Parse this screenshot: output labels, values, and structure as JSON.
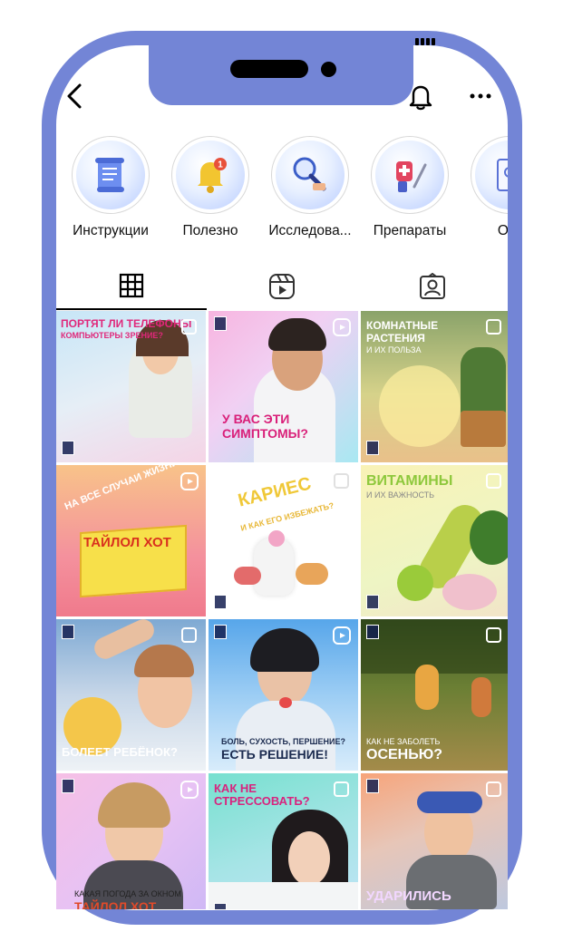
{
  "status_bar": {
    "time": ""
  },
  "highlights": [
    {
      "label": "Инструкции",
      "icon": "scroll-icon"
    },
    {
      "label": "Полезно",
      "icon": "bell-notification-icon",
      "badge": "1"
    },
    {
      "label": "Исследова...",
      "icon": "magnifier-icon"
    },
    {
      "label": "Препараты",
      "icon": "medicine-icon"
    },
    {
      "label": "Отз",
      "icon": "review-icon"
    }
  ],
  "tabs": [
    {
      "name": "posts",
      "icon": "grid-icon",
      "active": true
    },
    {
      "name": "reels",
      "icon": "reels-icon",
      "active": false
    },
    {
      "name": "tagged",
      "icon": "tagged-icon",
      "active": false
    }
  ],
  "posts": [
    {
      "line1": "ПОРТЯТ ЛИ ТЕЛЕФОНЫ",
      "line2": "КОМПЬЮТЕРЫ ЗРЕНИЕ?",
      "type": "multi",
      "colors": [
        "#c9e7f6",
        "#f3d3e8"
      ]
    },
    {
      "line1": "У ВАС ЭТИ",
      "line2": "СИМПТОМЫ?",
      "type": "reel",
      "colors": [
        "#f4b6e0",
        "#a6e7f2"
      ]
    },
    {
      "line1": "КОМНАТНЫЕ",
      "line2": "РАСТЕНИЯ",
      "line3": "И ИХ ПОЛЬЗА",
      "type": "multi",
      "colors": [
        "#6f8c53",
        "#e9dd8b"
      ]
    },
    {
      "line1": "НА ВСЕ СЛУЧАИ ЖИЗНИ",
      "line2": "ТАЙЛОЛ ХОТ",
      "type": "reel",
      "colors": [
        "#f6b58b",
        "#f06c8b"
      ]
    },
    {
      "line1": "КАРИЕС",
      "line2": "И КАК ЕГО ИЗБЕЖАТЬ?",
      "type": "multi",
      "colors": [
        "#ffffff",
        "#f8f8f8"
      ]
    },
    {
      "line1": "ВИТАМИНЫ",
      "line2": "И ИХ ВАЖНОСТЬ",
      "type": "multi",
      "colors": [
        "#f7f0b0",
        "#e4f3c3"
      ]
    },
    {
      "line1": "БОЛЕЕТ РЕБЁНОК?",
      "type": "multi",
      "colors": [
        "#8ab2d6",
        "#e9eef4"
      ]
    },
    {
      "line1": "БОЛЬ, СУХОСТЬ, ПЕРШЕНИЕ?",
      "line2": "ЕСТЬ РЕШЕНИЕ!",
      "type": "reel",
      "colors": [
        "#5aa7e9",
        "#d8ecfb"
      ]
    },
    {
      "line1": "КАК НЕ ЗАБОЛЕТЬ",
      "line2": "ОСЕНЬЮ?",
      "type": "multi",
      "colors": [
        "#4f6a2b",
        "#d09b4b"
      ]
    },
    {
      "line1": "КАКАЯ ПОГОДА ЗА ОКНОМ",
      "line2": "ТАЙЛОЛ ХОТ",
      "type": "reel",
      "colors": [
        "#f3bfe3",
        "#dfb8f7"
      ]
    },
    {
      "line1": "КАК НЕ",
      "line2": "СТРЕССОВАТЬ?",
      "type": "multi",
      "colors": [
        "#7be1d1",
        "#b9e3f7"
      ]
    },
    {
      "line1": "УДАРИЛИСЬ",
      "type": "multi",
      "colors": [
        "#f8a57a",
        "#b8c8e4"
      ]
    }
  ]
}
